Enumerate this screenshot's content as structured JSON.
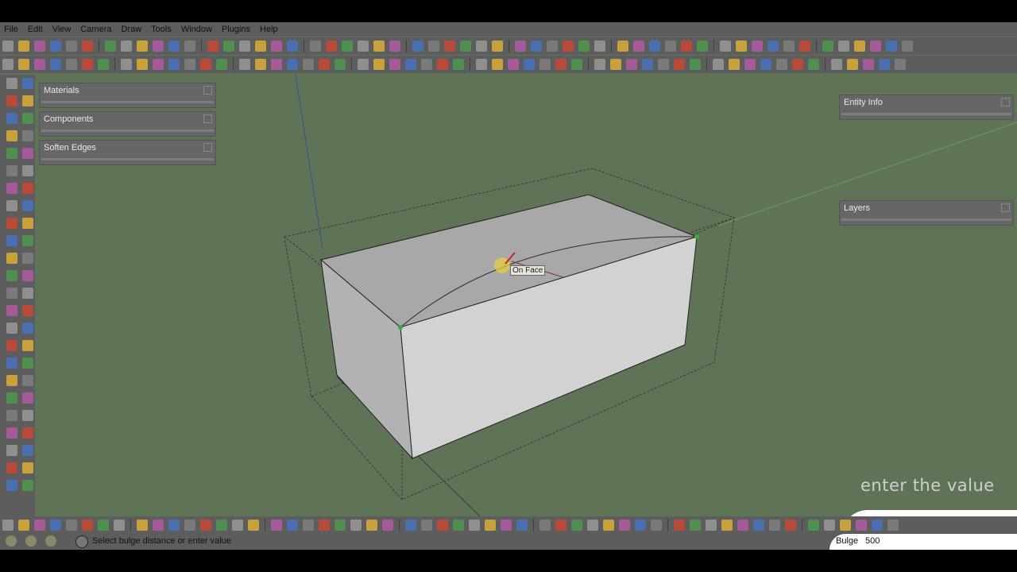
{
  "menu": [
    "File",
    "Edit",
    "View",
    "Camera",
    "Draw",
    "Tools",
    "Window",
    "Plugins",
    "Help"
  ],
  "panels": {
    "materials": "Materials",
    "components": "Components",
    "soften_edges": "Soften Edges",
    "entity_info": "Entity Info",
    "layers": "Layers"
  },
  "viewport": {
    "tooltip": "On Face"
  },
  "status": {
    "message": "Select bulge distance or enter value",
    "vcb_label": "Bulge",
    "vcb_value": "500"
  },
  "caption": "enter the value",
  "colors": {
    "background": "#5f7456",
    "toolbar": "#5d5d5d",
    "box_face": "#c9c9c9",
    "highlight": "#e8d23a"
  }
}
